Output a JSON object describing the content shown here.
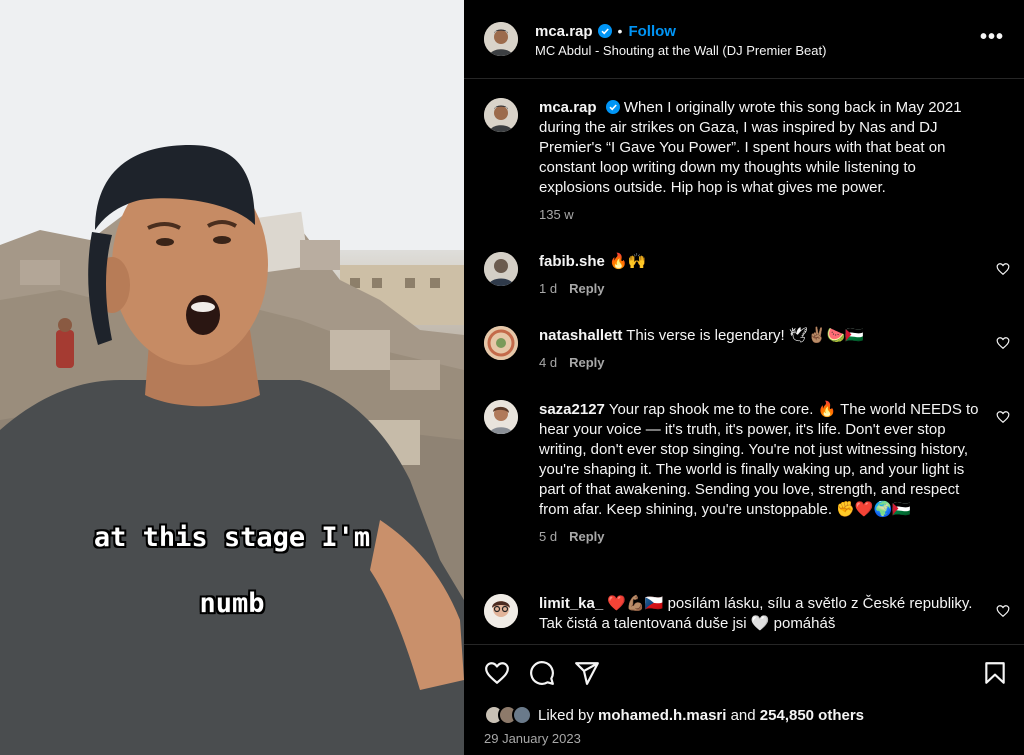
{
  "video": {
    "caption_line1": "at this stage I'm",
    "caption_line2": "numb"
  },
  "header": {
    "username": "mca.rap",
    "verified": true,
    "separator": "•",
    "follow_label": "Follow",
    "audio_title": "MC Abdul - Shouting at the Wall (DJ Premier Beat)",
    "more_label": "•••"
  },
  "post": {
    "username": "mca.rap",
    "text": "When I originally wrote this song back in May 2021 during the air strikes on Gaza, I was inspired by Nas and DJ Premier's “I Gave You Power”. I spent hours with that beat on constant loop writing down my thoughts while listening to explosions outside. Hip hop is what gives me power.",
    "age": "135 w"
  },
  "comments": [
    {
      "username": "fabib.she",
      "text": "🔥🙌",
      "age": "1 d",
      "reply_label": "Reply"
    },
    {
      "username": "natashallett",
      "text": "This verse is legendary! 🕊✌🏽🍉🇵🇸",
      "age": "4 d",
      "reply_label": "Reply"
    },
    {
      "username": "saza2127",
      "text": "Your rap shook me to the core. 🔥 The world NEEDS to hear your voice — it's truth, it's power, it's life. Don't ever stop writing, don't ever stop singing. You're not just witnessing history, you're shaping it. The world is finally waking up, and your light is part of that awakening. Sending you love, strength, and respect from afar. Keep shining, you're unstoppable. ✊❤️🌍🇵🇸",
      "age": "5 d",
      "reply_label": "Reply"
    },
    {
      "username": "limit_ka_",
      "text": "❤️💪🏽🇨🇿 posílám lásku, sílu a světlo z České republiky. Tak čistá a talentovaná duše jsi 🤍 pomáháš",
      "age": "",
      "reply_label": ""
    }
  ],
  "footer": {
    "liked_by_prefix": "Liked by",
    "liked_by_user": "mohamed.h.masri",
    "liked_by_and": "and",
    "liked_by_count": "254,850 others",
    "date": "29 January 2023"
  },
  "colors": {
    "background": "#000000",
    "link_blue": "#0095f6",
    "muted_text": "#a8a8a8",
    "divider": "#262626"
  }
}
